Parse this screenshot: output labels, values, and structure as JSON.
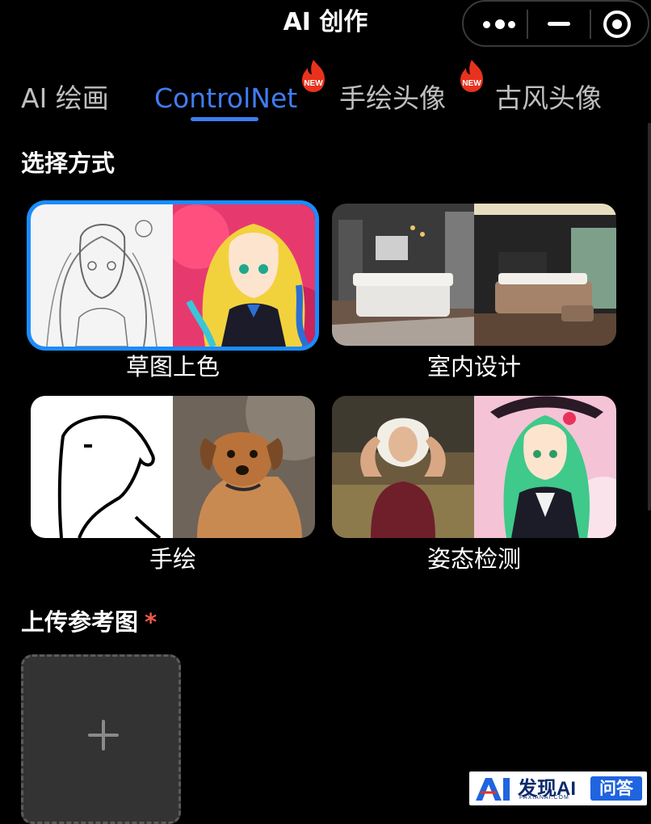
{
  "header": {
    "title": "AI 创作"
  },
  "tabs": [
    {
      "label": "AI 绘画"
    },
    {
      "label": "ControlNet",
      "badge": "NEW"
    },
    {
      "label": "手绘头像",
      "badge": "NEW"
    },
    {
      "label": "古风头像"
    }
  ],
  "method_section": {
    "title": "选择方式"
  },
  "methods": [
    {
      "label": "草图上色",
      "selected": true
    },
    {
      "label": "室内设计"
    },
    {
      "label": "手绘"
    },
    {
      "label": "姿态检测"
    }
  ],
  "upload": {
    "title": "上传参考图",
    "required_mark": "*"
  },
  "watermark": {
    "brand": "发现AI",
    "domain": "FAXIANAI.COM",
    "tag": "问答"
  },
  "colors": {
    "accent": "#3f7df3",
    "selected_border": "#1a8cff",
    "required": "#f05a4a",
    "badge": "#e8321e"
  }
}
